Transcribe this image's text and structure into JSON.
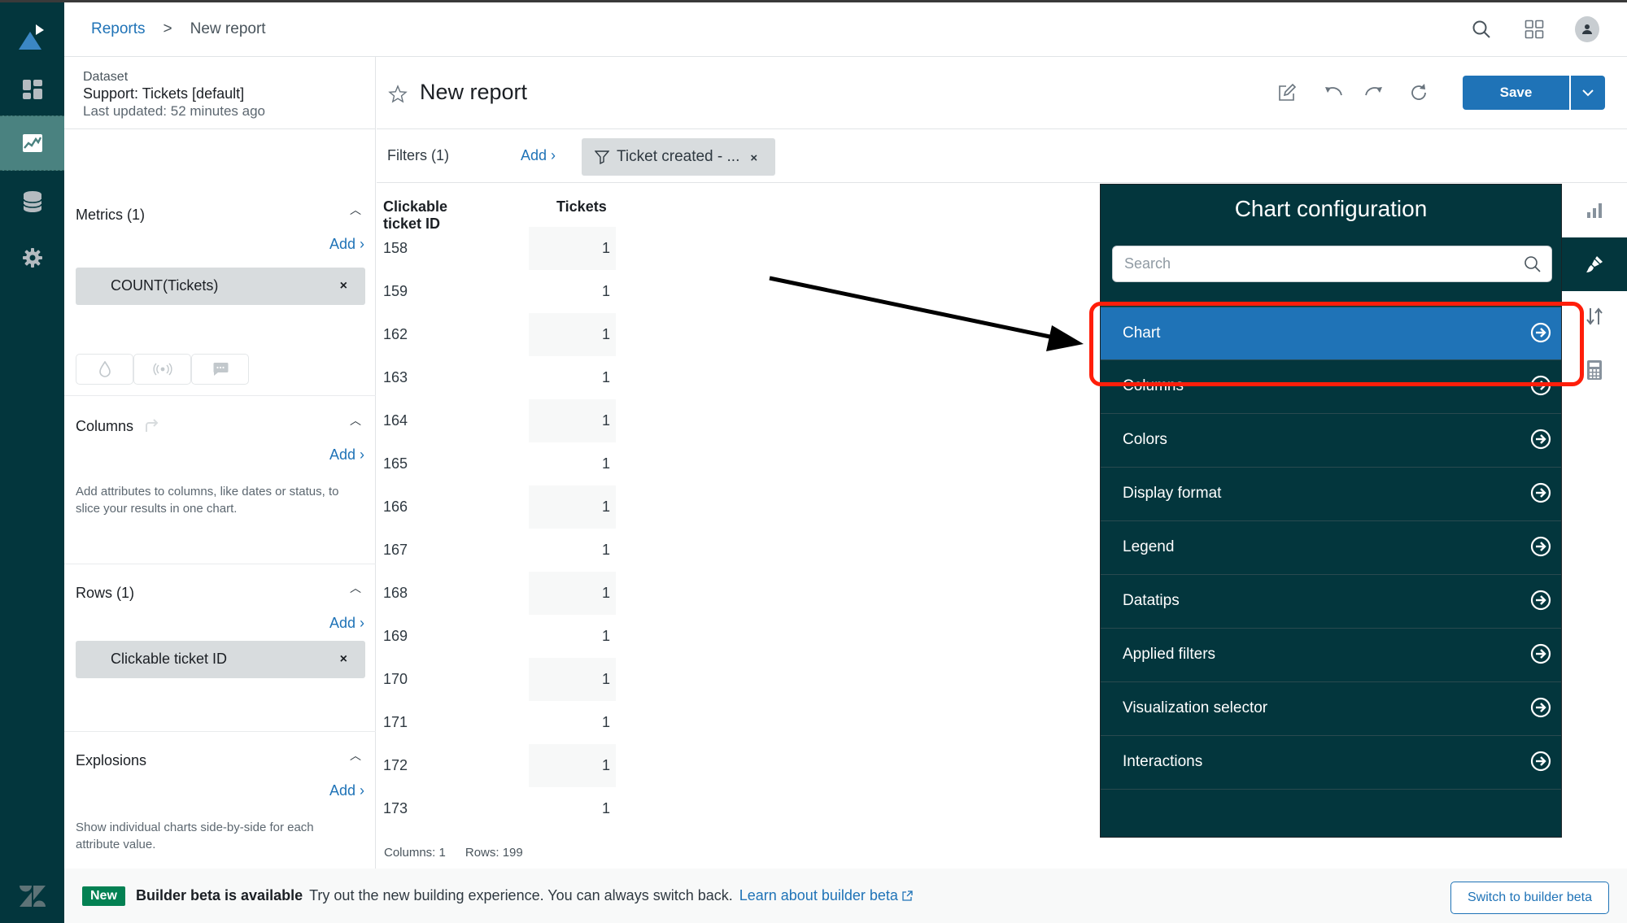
{
  "header": {
    "breadcrumb": [
      {
        "label": "Reports",
        "link": true
      },
      {
        "label": ">",
        "link": false
      },
      {
        "label": "New report",
        "link": false
      }
    ],
    "icons": [
      "search-icon",
      "apps-grid-icon",
      "user-avatar-icon"
    ]
  },
  "nav": {
    "items": [
      {
        "name": "explore-logo",
        "active": false
      },
      {
        "name": "dashboards",
        "active": false
      },
      {
        "name": "reports",
        "active": true
      },
      {
        "name": "datasets",
        "active": false
      },
      {
        "name": "admin-settings",
        "active": false
      }
    ]
  },
  "dataset": {
    "label": "Dataset",
    "name": "Support: Tickets [default]",
    "updated": "Last updated: 52 minutes ago"
  },
  "metrics": {
    "title": "Metrics (1)",
    "add": "Add ›",
    "items": [
      {
        "label": "COUNT(Tickets)",
        "remove": "×"
      }
    ],
    "tool_icons": [
      "droplet-icon",
      "broadcast-icon",
      "comment-icon"
    ]
  },
  "columns": {
    "title": "Columns",
    "add": "Add ›",
    "description": "Add attributes to columns, like dates or status, to slice your results in one chart."
  },
  "rows": {
    "title": "Rows (1)",
    "add": "Add ›",
    "items": [
      {
        "label": "Clickable ticket ID",
        "remove": "×"
      }
    ]
  },
  "explosions": {
    "title": "Explosions",
    "add": "Add ›",
    "description": "Show individual charts side-by-side for each attribute value."
  },
  "report": {
    "title": "New report",
    "save_label": "Save"
  },
  "filters": {
    "label": "Filters (1)",
    "add": "Add ›",
    "chip": "Ticket created - ...",
    "chip_remove": "×"
  },
  "table": {
    "headers": [
      "Clickable ticket ID",
      "Tickets"
    ],
    "rows": [
      [
        "158",
        "1"
      ],
      [
        "159",
        "1"
      ],
      [
        "162",
        "1"
      ],
      [
        "163",
        "1"
      ],
      [
        "164",
        "1"
      ],
      [
        "165",
        "1"
      ],
      [
        "166",
        "1"
      ],
      [
        "167",
        "1"
      ],
      [
        "168",
        "1"
      ],
      [
        "169",
        "1"
      ],
      [
        "170",
        "1"
      ],
      [
        "171",
        "1"
      ],
      [
        "172",
        "1"
      ],
      [
        "173",
        "1"
      ]
    ],
    "footer": {
      "columns": "Columns: 1",
      "rows": "Rows: 199"
    }
  },
  "chart_config": {
    "title": "Chart configuration",
    "search_placeholder": "Search",
    "items": [
      {
        "label": "Chart",
        "active": true
      },
      {
        "label": "Columns",
        "active": false
      },
      {
        "label": "Colors",
        "active": false
      },
      {
        "label": "Display format",
        "active": false
      },
      {
        "label": "Legend",
        "active": false
      },
      {
        "label": "Datatips",
        "active": false
      },
      {
        "label": "Applied filters",
        "active": false
      },
      {
        "label": "Visualization selector",
        "active": false
      },
      {
        "label": "Interactions",
        "active": false
      }
    ]
  },
  "right_strip": {
    "items": [
      {
        "name": "chart-type-icon",
        "active": false
      },
      {
        "name": "paintbrush-icon",
        "active": true
      },
      {
        "name": "sort-icon",
        "active": false
      },
      {
        "name": "calculator-icon",
        "active": false
      }
    ]
  },
  "banner": {
    "badge": "New",
    "title": "Builder beta is available",
    "text": "Try out the new building experience. You can always switch back.",
    "link": "Learn about builder beta",
    "button": "Switch to builder beta"
  },
  "colors": {
    "nav_bg": "#03363d",
    "nav_active": "#4a8280",
    "accent_blue": "#1f73b7",
    "highlight_red": "#ff1e0a",
    "badge_green": "#038153"
  }
}
